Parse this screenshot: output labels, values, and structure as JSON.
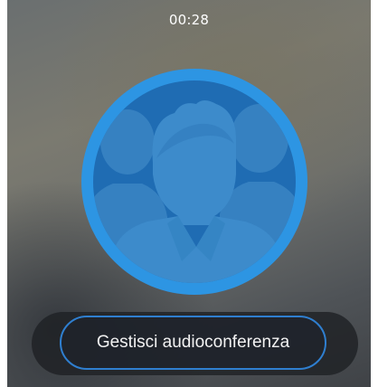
{
  "call": {
    "timer": "00:28"
  },
  "avatar": {
    "icon": "group-conference-avatar-icon",
    "ring_color": "#2d95e3",
    "fill_color": "#1f6cb3"
  },
  "actions": {
    "manage_conference_label": "Gestisci audioconferenza",
    "button_border_color": "#2f7fd0"
  }
}
